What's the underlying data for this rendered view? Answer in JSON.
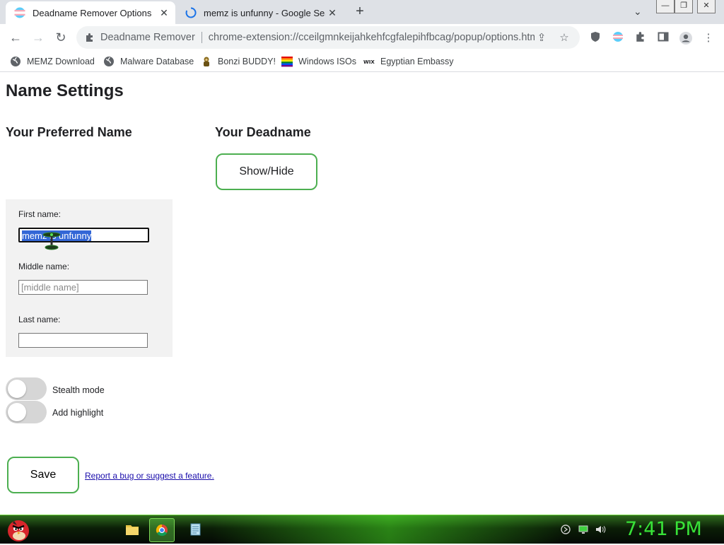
{
  "browser": {
    "tabs": [
      {
        "title": "Deadname Remover Options",
        "active": true
      },
      {
        "title": "memz is unfunny - Google Search",
        "active": false
      }
    ],
    "omnibox": {
      "host": "Deadname Remover",
      "url": "chrome-extension://cceilgmnkeijahkehfcgfalepihfbcag/popup/options.html"
    },
    "bookmarks": [
      "MEMZ Download",
      "Malware Database",
      "Bonzi BUDDY!",
      "Windows ISOs",
      "Egyptian Embassy"
    ]
  },
  "page": {
    "title": "Name Settings",
    "preferred_heading": "Your Preferred Name",
    "deadname_heading": "Your Deadname",
    "showhide_label": "Show/Hide",
    "fields": {
      "first": {
        "label": "First name:",
        "value": "memz is unfunny"
      },
      "middle": {
        "label": "Middle name:",
        "placeholder": "[middle name]"
      },
      "last": {
        "label": "Last name:",
        "value": ""
      }
    },
    "toggles": [
      {
        "label": "Stealth mode",
        "on": false
      },
      {
        "label": "Add highlight",
        "on": false
      }
    ],
    "save_label": "Save",
    "report_link": "Report a bug or suggest a feature."
  },
  "taskbar": {
    "clock": "7:41 PM"
  },
  "colors": {
    "accent_green": "#4caf50",
    "tab_bar": "#dee1e6",
    "clock": "#38e238"
  }
}
